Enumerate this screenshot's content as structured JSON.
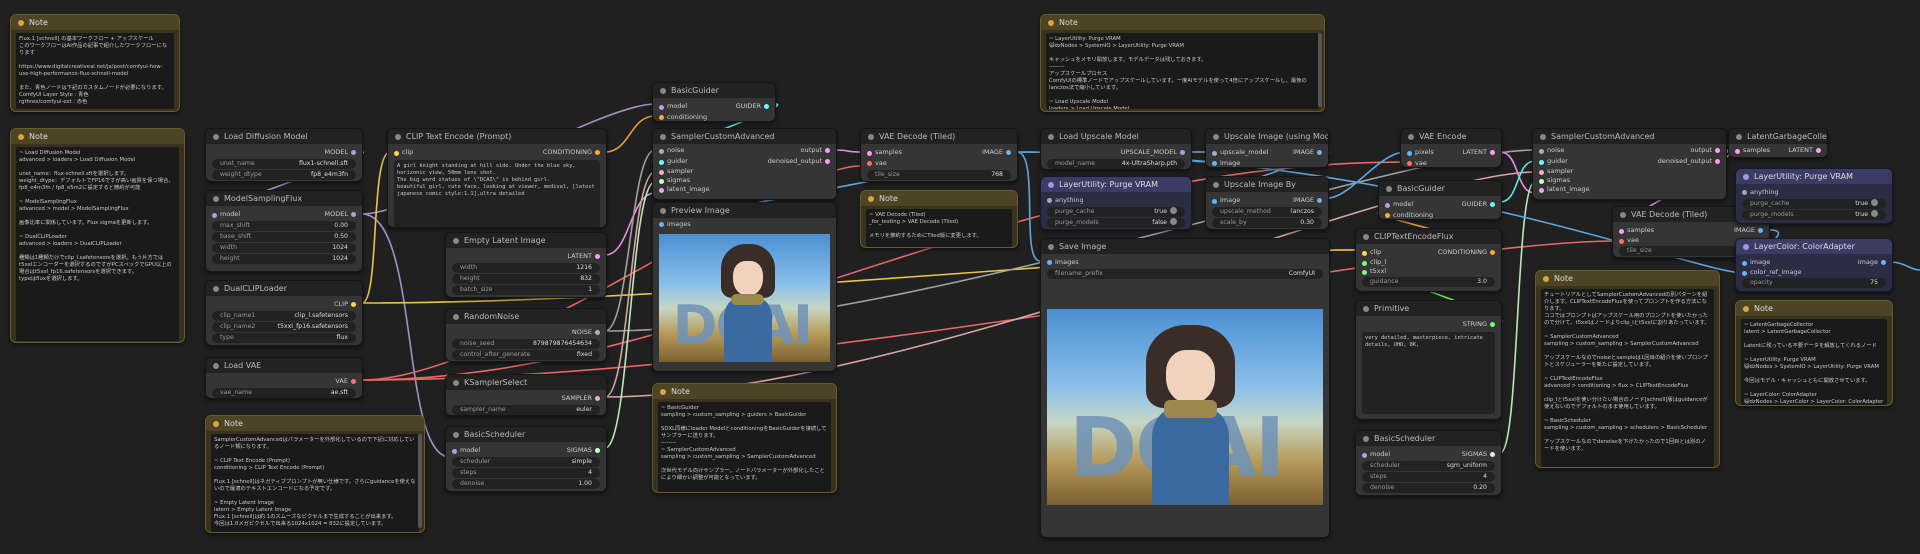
{
  "colors": {
    "model": "#b39ddb",
    "clip": "#ffd54f",
    "conditioning": "#ffa931",
    "latent": "#ff9cf9",
    "vae": "#ff6e6e",
    "image": "#64b5f6",
    "sigmas": "#cdffcd",
    "noise": "#b0b0b0",
    "guider": "#66ffff",
    "sampler": "#ecb4b4",
    "upscale": "#9fa8da",
    "string": "#77ff77"
  },
  "note_tl": {
    "title": "Note",
    "text": "Flux.1 [schnell] の基本ワークフロー + アップスケール\nこのワークフローはAI作品の記事で紹介したワークフローになります\n\nhttps://www.digitalcreativeai.net/ja/post/comfyui-how-use-high-performance-flux-schnell-model\n\nまた、青色ノードは下記のカスタムノードが必要になります。\nComfyUI Layer Style : 青色\nrgthree/comfyui-ext : 赤色"
  },
  "note_l": {
    "title": "Note",
    "text": "~ Load Diffusion Model\nadvanced > loaders > Load Diffusion Model\n\nunet_name：flux-schnell.sftを選択します。\nweight_dtype：デフォルトでFP16ですが高い画質を保つ場合、\nfp8_e4m3fn / fp8_e5m2に設定すると節約が可能\n\n~ ModelSamplingFlux\nadvanced > model > ModelSamplingFlux\n\n画像比率に関係しています。Flux sigmaを更新します。\n\n~ DualCLIPLoader\nadvanced > loaders > DualCLIPLoader\n\n種類は1種類だけでclip_l.safetensorsを選択。もう片方ではt5xxlエンコーダーを選択するのですがPCスペックでGPU以上の場合はt5xxl_fp16.safetensorsを選択できます。\ntypeはfluxを選択します。"
  },
  "note_b": {
    "title": "Note",
    "text": "SamplerCustomAdvancedはパラメーターを外部化しているので下記に対応しているノード類になります。\n\n~ CLIP Text Encode (Prompt)\nconditioning > CLIP Text Encode (Prompt)\n\nFlux.1 [schnell]はネガティブプロンプトが無い仕様です。さらにguidanceを使えないので最適のテキストエンコードになる予定です。\n\n~ Empty Latent Image\nlatent > Empty Latent Image\nFlux.1 [schnell]は約.1のスムーズなピクセルまで生成することが出来ます。\n今回は1.0メガピクセルで出来る1024x1024 = 832に設定しています。"
  },
  "load_diff": {
    "title": "Load Diffusion Model",
    "out": "MODEL",
    "w": [
      [
        "unet_name",
        "flux1-schnell.sft"
      ],
      [
        "weight_dtype",
        "fp8_e4m3fn"
      ]
    ]
  },
  "msf": {
    "title": "ModelSamplingFlux",
    "in": "model",
    "out": "MODEL",
    "w": [
      [
        "max_shift",
        "0.00"
      ],
      [
        "base_shift",
        "0.50"
      ],
      [
        "width",
        "1024"
      ],
      [
        "height",
        "1024"
      ]
    ]
  },
  "dual": {
    "title": "DualCLIPLoader",
    "out": "CLIP",
    "w": [
      [
        "clip_name1",
        "clip_l.safetensors"
      ],
      [
        "clip_name2",
        "t5xxl_fp16.safetensors"
      ],
      [
        "type",
        "flux"
      ]
    ]
  },
  "vae_l": {
    "title": "Load VAE",
    "out": "VAE",
    "w": [
      [
        "vae_name",
        "ae.sft"
      ]
    ]
  },
  "clip_te": {
    "title": "CLIP Text Encode (Prompt)",
    "in": "clip",
    "out": "CONDITIONING",
    "text": "A girl knight standing at hill side. Under the blue sky, horizonic view, 50mm lens shot.\nThe big word statues of \\\"DCAI\\\" is behind girl.\nbeautiful girl, cute face, looking at viewer, medival, [latest japanese comic style:1.1],ultra detailed"
  },
  "empty": {
    "title": "Empty Latent Image",
    "out": "LATENT",
    "w": [
      [
        "width",
        "1216"
      ],
      [
        "height",
        "832"
      ],
      [
        "batch_size",
        "1"
      ]
    ]
  },
  "rnoise": {
    "title": "RandomNoise",
    "out": "NOISE",
    "w": [
      [
        "noise_seed",
        "879879876454634"
      ],
      [
        "control_after_generate",
        "fixed"
      ]
    ]
  },
  "ksel": {
    "title": "KSamplerSelect",
    "out": "SAMPLER",
    "w": [
      [
        "sampler_name",
        "euler"
      ]
    ]
  },
  "bsched": {
    "title": "BasicScheduler",
    "in": "model",
    "out": "SIGMAS",
    "w": [
      [
        "scheduler",
        "simple"
      ],
      [
        "steps",
        "4"
      ],
      [
        "denoise",
        "1.00"
      ]
    ]
  },
  "bguider1": {
    "title": "BasicGuider",
    "in": [
      "model",
      "conditioning"
    ],
    "out": "GUIDER"
  },
  "sca1": {
    "title": "SamplerCustomAdvanced",
    "in": [
      "noise",
      "guider",
      "sampler",
      "sigmas",
      "latent_image"
    ],
    "out": [
      "output",
      "denoised_output"
    ]
  },
  "preview": {
    "title": "Preview Image",
    "in": "images"
  },
  "note_m": {
    "title": "Note",
    "text": "~ BasicGuider\nsampling > custom_sampling > guiders > BasicGuider\n\nSDXL同様にloader ModelとconditioningをBasicGuiderを接続してサンプラーに送ります。\n--------\n~ SamplerCustomAdvanced\nsampling > custom_sampling > SamplerCustomAdvanced\n\n次世代モデル向けサンプラー。ノードパラメーターが外部化したことにより細かい調整が可能となっています。"
  },
  "vae_dec": {
    "title": "VAE Decode (Tiled)",
    "in": [
      "samples",
      "vae"
    ],
    "out": "IMAGE",
    "w": [
      [
        "tile_size",
        "768"
      ]
    ]
  },
  "note_v": {
    "title": "Note",
    "text": "~ VAE Decode (Tiled)\n_for_testing > VAE Decode (Tiled)\n\nメモリを節約するためにTiled版に変更します。"
  },
  "note_top": {
    "title": "Note",
    "text": "~ LayerUtility: Purge VRAM\n😺dzNodes > SystemIO > LayerUtility: Purge VRAM\n\nキャッシュをメモリ開放します。モデルデータは残しておきます。\n--------\nアップスケールプロセス\nComfyUIの標準ノードでアップスケールしています。一度AIモデルを使って4倍にアップスケールし、最後のlanczos法で縮小しています。\n\n~ Load Upscale Model\nloaders > Load Upscale Model"
  },
  "lum": {
    "title": "Load Upscale Model",
    "out": "UPSCALE_MODEL",
    "w": [
      [
        "model_name",
        "4x-UltraSharp.pth"
      ]
    ]
  },
  "purge1": {
    "title": "LayerUtility: Purge VRAM",
    "in": "anything",
    "w": [
      [
        "purge_cache",
        "true"
      ],
      [
        "purge_models",
        "false"
      ]
    ]
  },
  "save": {
    "title": "Save Image",
    "in": "images",
    "w": [
      [
        "filename_prefix",
        "ComfyUI"
      ]
    ]
  },
  "uiwm": {
    "title": "Upscale Image (using Model)",
    "in": [
      "upscale_model",
      "image"
    ],
    "out": "IMAGE"
  },
  "uib": {
    "title": "Upscale Image By",
    "in": "image",
    "out": "IMAGE",
    "w": [
      [
        "upscale_method",
        "lanczos"
      ],
      [
        "scale_by",
        "0.30"
      ]
    ]
  },
  "vae_enc": {
    "title": "VAE Encode",
    "in": [
      "pixels",
      "vae"
    ],
    "out": "LATENT"
  },
  "bguider2": {
    "title": "BasicGuider",
    "in": [
      "model",
      "conditioning"
    ],
    "out": "GUIDER"
  },
  "ctef": {
    "title": "CLIPTextEncodeFlux",
    "in": [
      "clip",
      "clip_l",
      "t5xxl"
    ],
    "out": "CONDITIONING",
    "w": [
      [
        "guidance",
        "3.0"
      ]
    ]
  },
  "prim": {
    "title": "Primitive",
    "out": "STRING",
    "text": "very detailed, masterpiece, intricate details, UHD, 8K,"
  },
  "bsched2": {
    "title": "BasicScheduler",
    "in": "model",
    "out": "SIGMAS",
    "w": [
      [
        "scheduler",
        "sgm_uniform"
      ],
      [
        "steps",
        "4"
      ],
      [
        "denoise",
        "0.20"
      ]
    ]
  },
  "sca2": {
    "title": "SamplerCustomAdvanced",
    "in": [
      "noise",
      "guider",
      "sampler",
      "sigmas",
      "latent_image"
    ],
    "out": [
      "output",
      "denoised_output"
    ]
  },
  "note_r": {
    "title": "Note",
    "text": "チュートリアルとしてSamplerCustomAdvancedの別パターンを紹介します。CLIPTextEncodeFluxを使ってプロンプトを作る方法になります。\nココではプロンプトはアップスケール用のプロンプトを使いたかったので分けて、t5xxlはノードよりclip_lとt5xxlに割りあたっています。\n\n~ SamplerCustomAdvanced\nsampling > custom_sampling > SamplerCustomAdvanced\n\nアップスケールなのでnoiseとsampleは1回目の紹介を使いプロンプトとスケジューラーを新たに設定しています。\n\n~ CLIPTextEncodeFlux\nadvanced > conditioning > flux > CLIPTextEncodeFlux\n\nclip_lとt5xxlを使い分けたい場合のノード[schnell]版はguidanceが使えないのでデフォルトのまま使用しています。\n\n~ BasicScheduler\nsampling > custom_sampling > schedulers > BasicScheduler\n\nアップスケールなのでdenoiseを下げたかったので1回目とは別のノードを使います。"
  },
  "vae_dec2": {
    "title": "VAE Decode (Tiled)",
    "in": [
      "samples",
      "vae"
    ],
    "out": "IMAGE",
    "w": [
      [
        "tile_size",
        "768"
      ]
    ]
  },
  "lgc": {
    "title": "LatentGarbageCollector",
    "in": "samples",
    "out": "LATENT"
  },
  "purge2": {
    "title": "LayerUtility: Purge VRAM",
    "in": "anything",
    "w": [
      [
        "purge_cache",
        "true"
      ],
      [
        "purge_models",
        "true"
      ]
    ]
  },
  "lcadapt": {
    "title": "LayerColor: ColorAdapter",
    "in": [
      "image",
      "color_ref_image"
    ],
    "out": "image",
    "w": [
      [
        "opacity",
        "75"
      ]
    ]
  },
  "note_fr": {
    "title": "Note",
    "text": "~ LatentGarbageCollector\nlatent > LatentGarbageCollector\n\nLatentに残っている不要データを解放してくれるノード\n\n~ LayerUtility: Purge VRAM\n😺dzNodes > SystemIO > LayerUtility: Purge VRAM\n\n今回はモデル・キャッシュともに開放させています。\n\n~ LayerColor: ColorAdapter\n😺dzNodes > LayerColor > LayerColor: ColorAdapter"
  },
  "image_words": {
    "letters": "DCAI"
  }
}
